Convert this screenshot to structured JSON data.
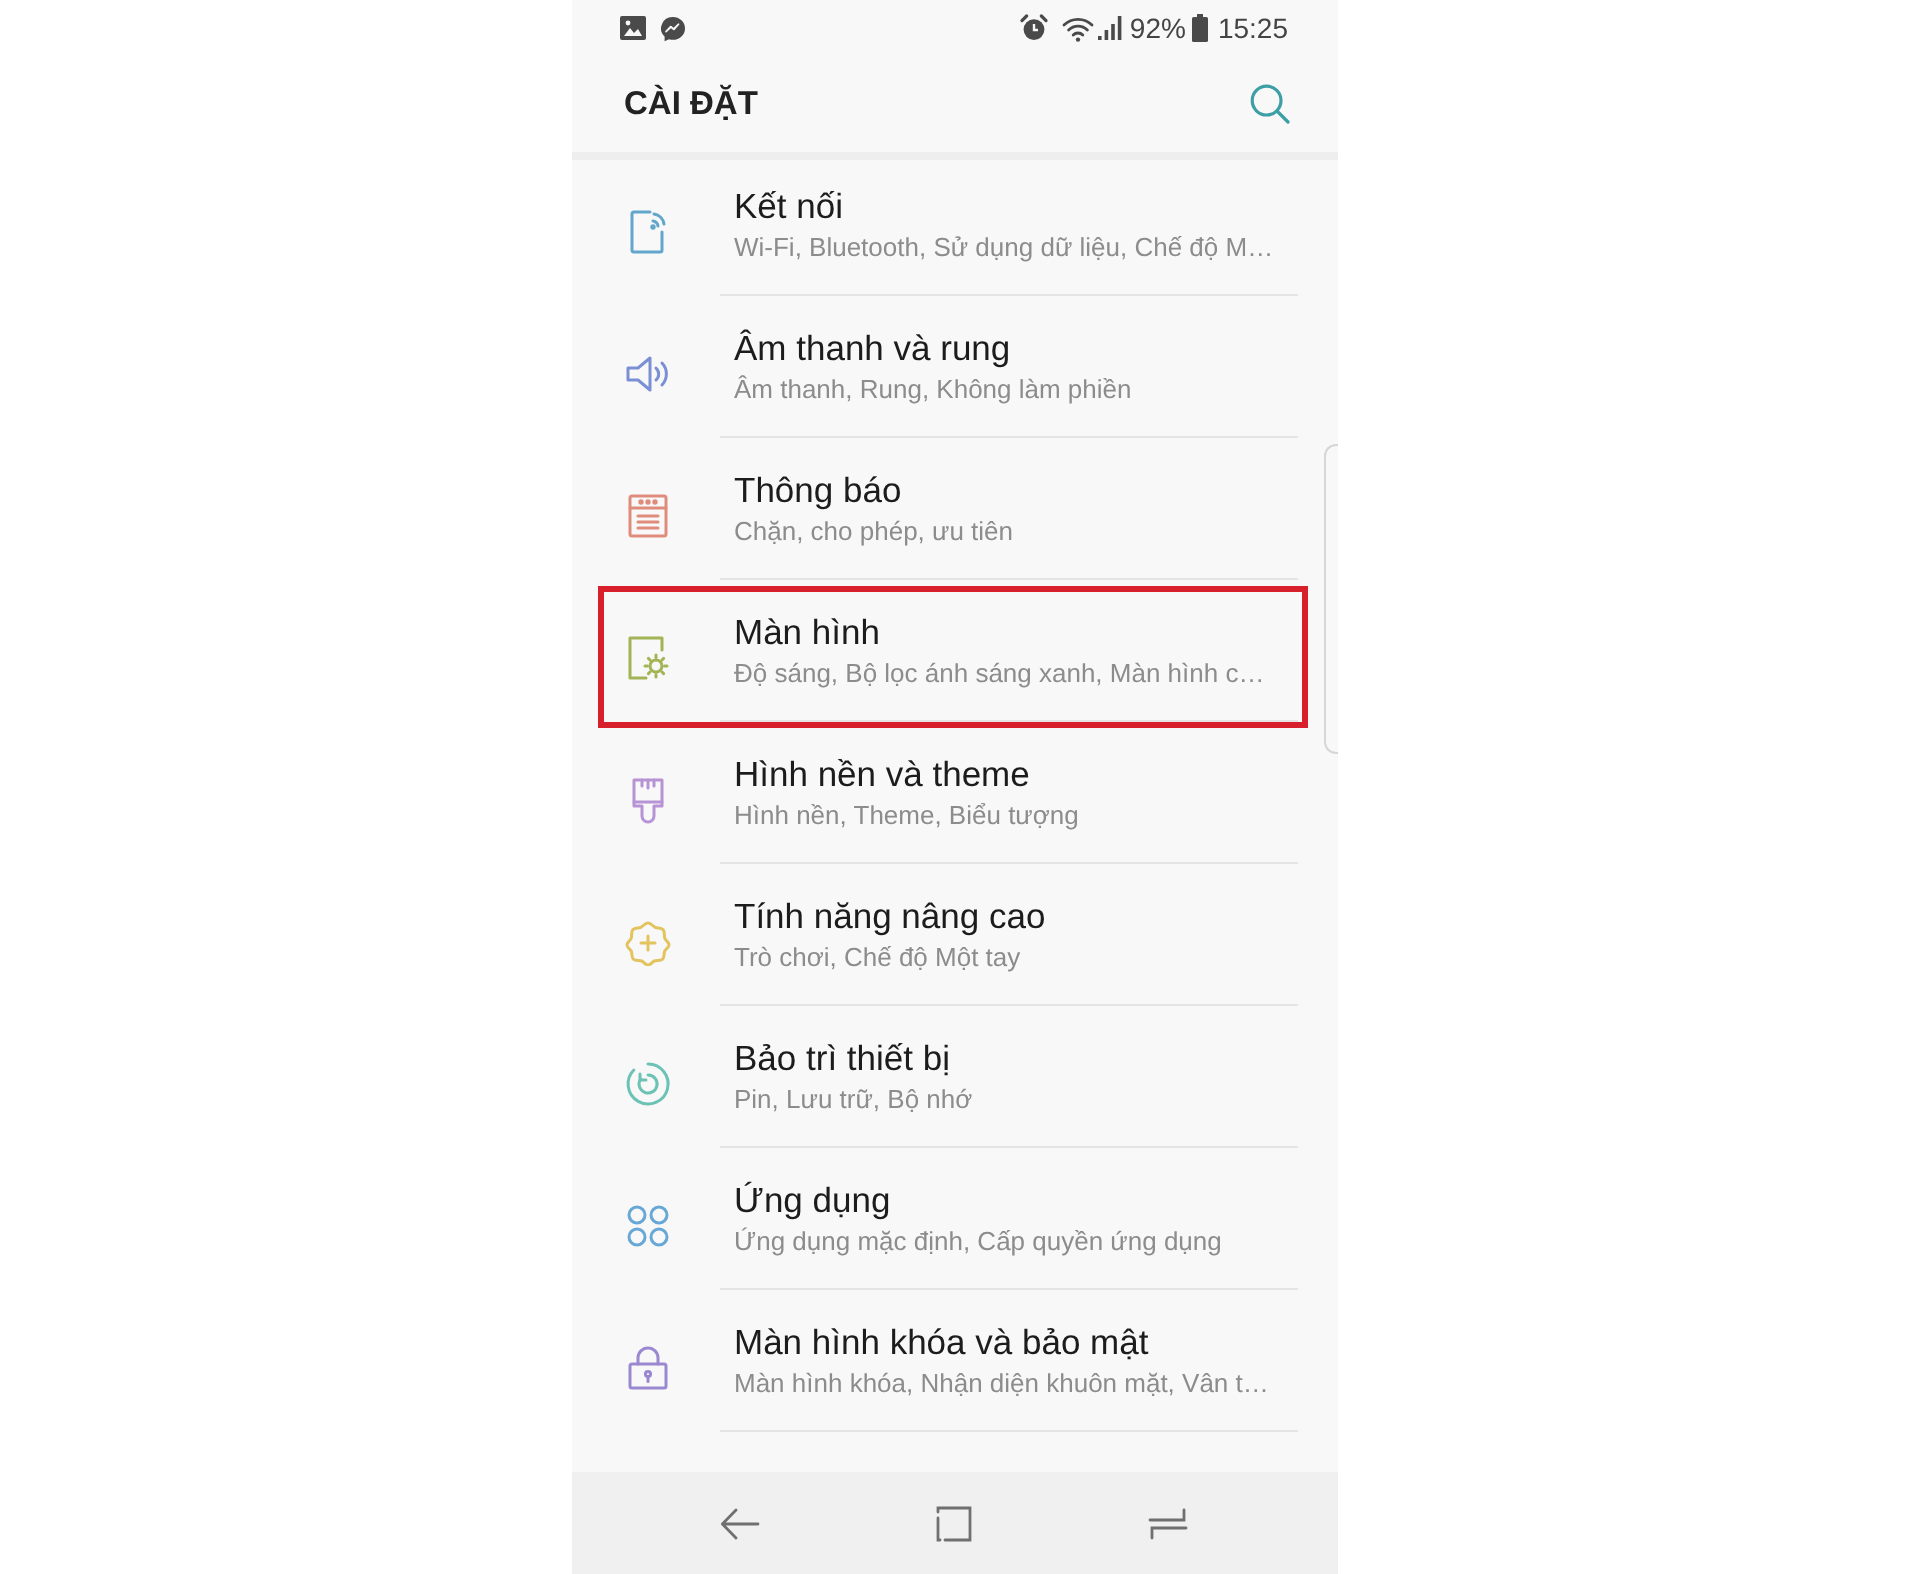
{
  "status_bar": {
    "battery": "92%",
    "time": "15:25"
  },
  "header": {
    "title": "CÀI ĐẶT"
  },
  "items": [
    {
      "title": "Kết nối",
      "subtitle": "Wi-Fi, Bluetooth, Sử dụng dữ liệu, Chế độ M…",
      "color": "#62a6cc",
      "highlighted": false
    },
    {
      "title": "Âm thanh và rung",
      "subtitle": "Âm thanh, Rung, Không làm phiền",
      "color": "#7b90d4",
      "highlighted": false
    },
    {
      "title": "Thông báo",
      "subtitle": "Chặn, cho phép, ưu tiên",
      "color": "#e08c7c",
      "highlighted": false
    },
    {
      "title": "Màn hình",
      "subtitle": "Độ sáng, Bộ lọc ánh sáng xanh, Màn hình c…",
      "color": "#a2b455",
      "highlighted": true
    },
    {
      "title": "Hình nền và theme",
      "subtitle": "Hình nền, Theme, Biểu tượng",
      "color": "#b793d6",
      "highlighted": false
    },
    {
      "title": "Tính năng nâng cao",
      "subtitle": "Trò chơi, Chế độ Một tay",
      "color": "#e2c35e",
      "highlighted": false
    },
    {
      "title": "Bảo trì thiết bị",
      "subtitle": "Pin, Lưu trữ, Bộ nhớ",
      "color": "#6cc2b4",
      "highlighted": false
    },
    {
      "title": "Ứng dụng",
      "subtitle": "Ứng dụng mặc định, Cấp quyền ứng dụng",
      "color": "#68a8d6",
      "highlighted": false
    },
    {
      "title": "Màn hình khóa và bảo mật",
      "subtitle": "Màn hình khóa, Nhận diện khuôn mặt, Vân t…",
      "color": "#9a88d0",
      "highlighted": false
    }
  ]
}
